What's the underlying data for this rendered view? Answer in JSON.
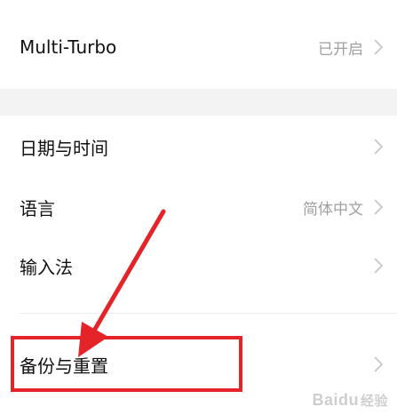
{
  "settings": {
    "multi_turbo": {
      "label": "Multi-Turbo",
      "value": "已开启"
    },
    "date_time": {
      "label": "日期与时间"
    },
    "language": {
      "label": "语言",
      "value": "简体中文"
    },
    "input_method": {
      "label": "输入法"
    },
    "backup_reset": {
      "label": "备份与重置"
    }
  },
  "icons": {
    "chevron": "chevron-right-icon"
  },
  "annotation": {
    "highlight_color": "#e5242a"
  },
  "watermark": {
    "brand": "Baidu",
    "sub": "经验"
  }
}
